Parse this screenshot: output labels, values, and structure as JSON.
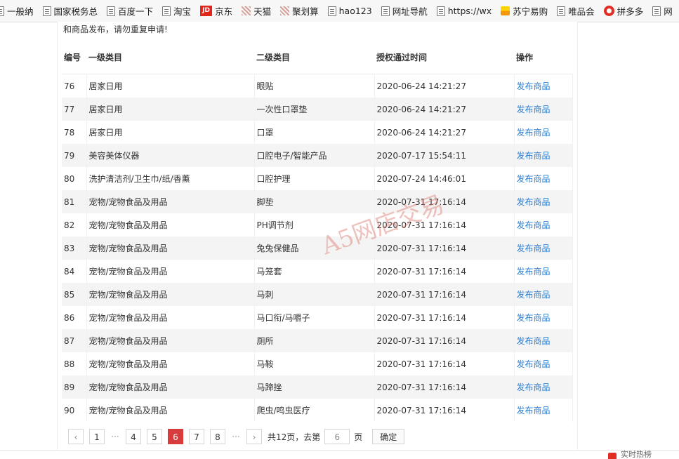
{
  "bookmarks": [
    {
      "label": "一般纳",
      "icon": "page-icon"
    },
    {
      "label": "国家税务总",
      "icon": "page-icon"
    },
    {
      "label": "百度一下",
      "icon": "page-icon"
    },
    {
      "label": "淘宝",
      "icon": "page-icon"
    },
    {
      "label": "京东",
      "icon": "jd-logo-icon",
      "icon_text": "JD"
    },
    {
      "label": "天猫",
      "icon": "tmall-icon"
    },
    {
      "label": "聚划算",
      "icon": "juhuasuan-icon"
    },
    {
      "label": "hao123",
      "icon": "page-icon"
    },
    {
      "label": "网址导航",
      "icon": "page-icon"
    },
    {
      "label": "https://wx",
      "icon": "page-icon"
    },
    {
      "label": "苏宁易购",
      "icon": "suning-icon"
    },
    {
      "label": "唯品会",
      "icon": "page-icon"
    },
    {
      "label": "拼多多",
      "icon": "pinduoduo-icon"
    },
    {
      "label": "网",
      "icon": "page-icon"
    }
  ],
  "notice": "和商品发布，请勿重复申请!",
  "table": {
    "headers": {
      "id": "编号",
      "category1": "一级类目",
      "category2": "二级类目",
      "time": "授权通过时间",
      "action": "操作"
    },
    "rows": [
      {
        "id": "76",
        "category1": "居家日用",
        "category2": "眼贴",
        "time": "2020-06-24 14:21:27",
        "action": "发布商品"
      },
      {
        "id": "77",
        "category1": "居家日用",
        "category2": "一次性口罩垫",
        "time": "2020-06-24 14:21:27",
        "action": "发布商品"
      },
      {
        "id": "78",
        "category1": "居家日用",
        "category2": "口罩",
        "time": "2020-06-24 14:21:27",
        "action": "发布商品"
      },
      {
        "id": "79",
        "category1": "美容美体仪器",
        "category2": "口腔电子/智能产品",
        "time": "2020-07-17 15:54:11",
        "action": "发布商品"
      },
      {
        "id": "80",
        "category1": "洗护清洁剂/卫生巾/纸/香薰",
        "category2": "口腔护理",
        "time": "2020-07-24 14:46:01",
        "action": "发布商品"
      },
      {
        "id": "81",
        "category1": "宠物/宠物食品及用品",
        "category2": "脚垫",
        "time": "2020-07-31 17:16:14",
        "action": "发布商品"
      },
      {
        "id": "82",
        "category1": "宠物/宠物食品及用品",
        "category2": "PH调节剂",
        "time": "2020-07-31 17:16:14",
        "action": "发布商品"
      },
      {
        "id": "83",
        "category1": "宠物/宠物食品及用品",
        "category2": "兔兔保健品",
        "time": "2020-07-31 17:16:14",
        "action": "发布商品"
      },
      {
        "id": "84",
        "category1": "宠物/宠物食品及用品",
        "category2": "马笼套",
        "time": "2020-07-31 17:16:14",
        "action": "发布商品"
      },
      {
        "id": "85",
        "category1": "宠物/宠物食品及用品",
        "category2": "马刺",
        "time": "2020-07-31 17:16:14",
        "action": "发布商品"
      },
      {
        "id": "86",
        "category1": "宠物/宠物食品及用品",
        "category2": "马口衔/马嚼子",
        "time": "2020-07-31 17:16:14",
        "action": "发布商品"
      },
      {
        "id": "87",
        "category1": "宠物/宠物食品及用品",
        "category2": "厕所",
        "time": "2020-07-31 17:16:14",
        "action": "发布商品"
      },
      {
        "id": "88",
        "category1": "宠物/宠物食品及用品",
        "category2": "马鞍",
        "time": "2020-07-31 17:16:14",
        "action": "发布商品"
      },
      {
        "id": "89",
        "category1": "宠物/宠物食品及用品",
        "category2": "马蹄挫",
        "time": "2020-07-31 17:16:14",
        "action": "发布商品"
      },
      {
        "id": "90",
        "category1": "宠物/宠物食品及用品",
        "category2": "爬虫/鸣虫医疗",
        "time": "2020-07-31 17:16:14",
        "action": "发布商品"
      }
    ]
  },
  "watermark": "A5网店交易",
  "pagination": {
    "prev": "‹",
    "next": "›",
    "pages": [
      "1",
      "4",
      "5",
      "6",
      "7",
      "8"
    ],
    "current": "6",
    "dots": "···",
    "total_text": "共12页，去第",
    "goto_value": "6",
    "page_suffix": "页",
    "confirm": "确定"
  },
  "status_bar": {
    "text": "实时热榜",
    "icon": "hot-list-icon"
  }
}
